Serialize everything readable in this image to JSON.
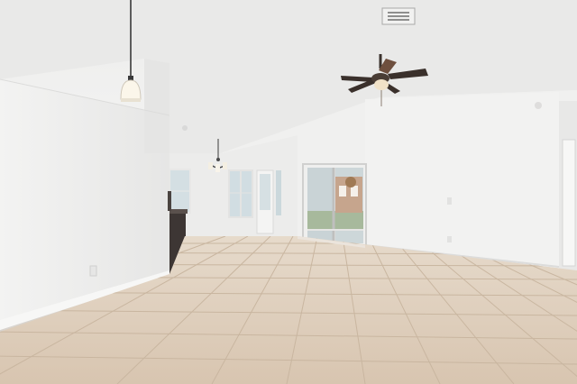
{
  "scene": {
    "kind": "photo",
    "subject": "empty-living-room",
    "palette": {
      "ceiling": "#efefee",
      "wall_light": "#f1f1f0",
      "wall_shadow": "#e2e2e1",
      "floor_tile": "#dccbb8",
      "floor_grout": "#cbb8a2",
      "window_glass": "#c9d7de",
      "fan_blade": "#3a302b",
      "cabinet": "#3b3533"
    },
    "icons": [
      "pendant-lamp-icon",
      "chandelier-icon",
      "ceiling-fan-icon",
      "air-vent-icon"
    ]
  }
}
